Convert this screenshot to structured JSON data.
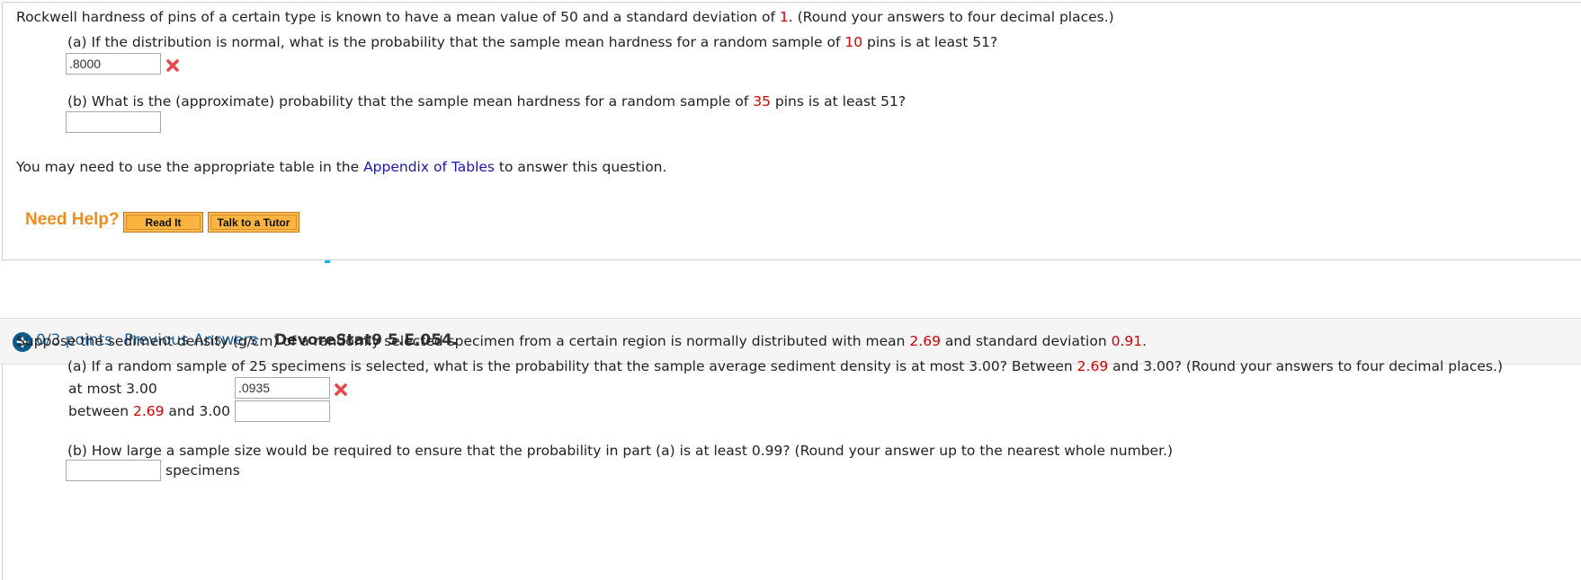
{
  "q1": {
    "intro_pre": "Rockwell hardness of pins of a certain type is known to have a mean value of 50 and a standard deviation of ",
    "intro_sd": "1",
    "intro_post": ". (Round your answers to four decimal places.)",
    "part_a": {
      "pre": "(a) If the distribution is normal, what is the probability that the sample mean hardness for a random sample of ",
      "n": "10",
      "post": " pins is at least 51?",
      "answer": ".8000",
      "status": "incorrect"
    },
    "part_b": {
      "pre": "(b) What is the (approximate) probability that the sample mean hardness for a random sample of ",
      "n": "35",
      "post": " pins is at least 51?",
      "answer": ""
    },
    "tables_pre": "You may need to use the appropriate table in the ",
    "tables_link": "Appendix of Tables",
    "tables_post": " to answer this question.",
    "help": {
      "label": "Need Help?",
      "read_it": "Read It",
      "talk_tutor": "Talk to a Tutor"
    }
  },
  "q2_header": {
    "expand_icon": "plus-circle-icon",
    "points": "0/3 points",
    "previous_answers": "Previous Answers",
    "problem_id": "DevoreStat9 5.E.054."
  },
  "q2": {
    "intro_pre": "Suppose the sediment density (g/cm) of a randomly selected specimen from a certain region is normally distributed with mean ",
    "mean": "2.69",
    "intro_mid": " and standard deviation ",
    "sd": "0.91",
    "intro_post": ".",
    "part_a": {
      "pre": "(a) If a random sample of 25 specimens is selected, what is the probability that the sample average sediment density is at most 3.00? Between ",
      "mean": "2.69",
      "post": " and 3.00? (Round your answers to four decimal places.)",
      "row1_label": "at most 3.00",
      "row1_answer": ".0935",
      "row1_status": "incorrect",
      "row2_label_pre": "between ",
      "row2_label_mean": "2.69",
      "row2_label_post": " and 3.00",
      "row2_answer": ""
    },
    "part_b": {
      "text": "(b) How large a sample size would be required to ensure that the probability in part (a) is at least 0.99? (Round your answer up to the nearest whole number.)",
      "answer": "",
      "unit": "specimens"
    }
  }
}
